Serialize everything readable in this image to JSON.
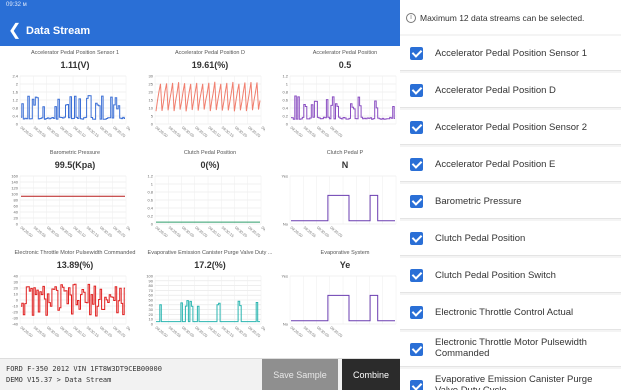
{
  "status": {
    "time": "09:32 ᴍ"
  },
  "header": {
    "back_icon": "chevron-left-icon",
    "title": "Data Stream"
  },
  "streams": [
    {
      "name": "Accelerator Pedal Position Sensor 1",
      "value": "1.11(V)",
      "color": "#3b6fd6",
      "y_ticks": [
        "2.4",
        "2",
        "1.6",
        "1.2",
        "0.8",
        "0.4",
        "0"
      ],
      "x_ticks": [
        "09:29:50",
        "09:29:55",
        "09:30:00",
        "09:30:05",
        "09:30:10",
        "09:30:15",
        "09:30:20",
        "09:30:25",
        "09:30:30"
      ]
    },
    {
      "name": "Accelerator Pedal Position D",
      "value": "19.61(%)",
      "color": "#f07e6e",
      "y_ticks": [
        "30",
        "25",
        "20",
        "15",
        "10",
        "5",
        "0"
      ],
      "x_ticks": [
        "09:29:50",
        "09:29:55",
        "09:30:00",
        "09:30:05",
        "09:30:10",
        "09:30:15",
        "09:30:20",
        "09:30:25",
        "09:30:30"
      ]
    },
    {
      "name": "Accelerator Pedal Position",
      "value": "0.5",
      "color": "#8a4ec2",
      "y_ticks": [
        "1.2",
        "1",
        "0.8",
        "0.6",
        "0.4",
        "0.2",
        "0"
      ],
      "x_ticks": [
        "09:29:50",
        "09:29:55",
        "09:30:00",
        "09:30:05"
      ]
    },
    {
      "name": "Barometric Pressure",
      "value": "99.5(Kpa)",
      "color": "#b71c1c",
      "y_ticks": [
        "160",
        "140",
        "120",
        "100",
        "80",
        "60",
        "40",
        "20",
        "0"
      ],
      "x_ticks": [
        "09:29:50",
        "09:29:55",
        "09:30:00",
        "09:30:05",
        "09:30:10",
        "09:30:15",
        "09:30:20",
        "09:30:25",
        "09:30:30"
      ]
    },
    {
      "name": "Clutch Pedal Position",
      "value": "0(%)",
      "color": "#2e9e6a",
      "y_ticks": [
        "1.2",
        "1",
        "0.8",
        "0.6",
        "0.4",
        "0.2",
        "0"
      ],
      "x_ticks": [
        "09:29:50",
        "09:29:55",
        "09:30:00",
        "09:30:05",
        "09:30:10",
        "09:30:15",
        "09:30:20",
        "09:30:25",
        "09:30:30"
      ]
    },
    {
      "name": "Clutch Pedal P",
      "value": "N",
      "color": "#6a3db0",
      "y_ticks": [
        "Yes",
        "No"
      ],
      "x_ticks": [
        "09:29:50",
        "09:29:55",
        "09:30:00",
        "09:30:05"
      ]
    },
    {
      "name": "Electronic Throttle Motor Pulsewidth Commanded",
      "value": "13.89(%)",
      "color": "#e02020",
      "y_ticks": [
        "40",
        "30",
        "20",
        "10",
        "0",
        "-10",
        "-20",
        "-30",
        "-40"
      ],
      "x_ticks": [
        "09:29:50",
        "09:29:55",
        "09:30:00",
        "09:30:05",
        "09:30:10",
        "09:30:15",
        "09:30:20",
        "09:30:25",
        "09:30:30"
      ]
    },
    {
      "name": "Evaporative Emission Canister Purge Valve Duty ...",
      "value": "17.2(%)",
      "color": "#2ab5b0",
      "y_ticks": [
        "100",
        "90",
        "80",
        "70",
        "60",
        "50",
        "40",
        "30",
        "20",
        "10",
        "0"
      ],
      "x_ticks": [
        "09:29:50",
        "09:29:55",
        "09:30:00",
        "09:30:05",
        "09:30:10",
        "09:30:15",
        "09:30:20",
        "09:30:25",
        "09:30:30"
      ]
    },
    {
      "name": "Evaporative System",
      "value": "Ye",
      "color": "#6a3db0",
      "y_ticks": [
        "Yes",
        "No"
      ],
      "x_ticks": [
        "09:29:50",
        "09:29:55",
        "09:30:00",
        "09:30:05"
      ]
    }
  ],
  "footer": {
    "vehicle": "FORD  F-350  2012  VIN  1FT8W3DT9CEB00000",
    "breadcrumb": "DEMO V15.37 > Data Stream",
    "save_label": "Save Sample",
    "combine_label": "Combine"
  },
  "panel": {
    "hint": "Maximum 12 data streams can be selected.",
    "info_icon": "info-icon",
    "items": [
      {
        "label": "Accelerator Pedal Position Sensor 1",
        "checked": true
      },
      {
        "label": "Accelerator Pedal Position D",
        "checked": true
      },
      {
        "label": "Accelerator Pedal Position Sensor 2",
        "checked": true
      },
      {
        "label": "Accelerator Pedal Position E",
        "checked": true
      },
      {
        "label": "Barometric Pressure",
        "checked": true
      },
      {
        "label": "Clutch Pedal Position",
        "checked": true
      },
      {
        "label": "Clutch Pedal Position Switch",
        "checked": true
      },
      {
        "label": "Electronic Throttle Control Actual",
        "checked": true
      },
      {
        "label": "Electronic Throttle Motor Pulsewidth Commanded",
        "checked": true
      },
      {
        "label": "Evaporative Emission Canister Purge Valve Duty Cycle",
        "checked": true
      }
    ]
  }
}
